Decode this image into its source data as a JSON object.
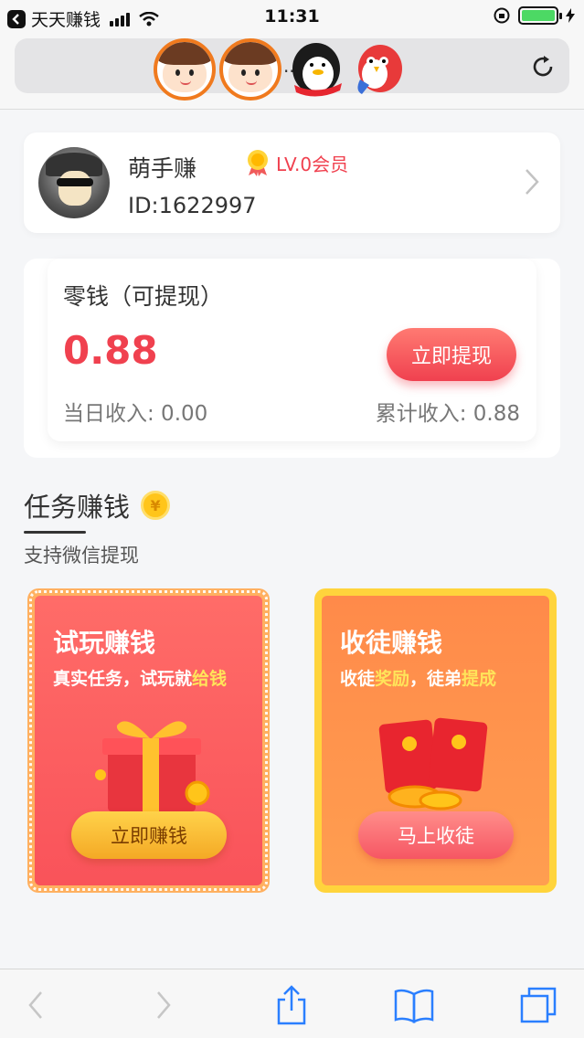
{
  "status_bar": {
    "back_app": "天天赚钱",
    "time": "11:31"
  },
  "browser": {
    "url": "..."
  },
  "user": {
    "name": "萌手赚",
    "id_text": "ID:1622997",
    "level": "LV.0会员"
  },
  "balance": {
    "title": "零钱（可提现）",
    "amount": "0.88",
    "withdraw_label": "立即提现",
    "today_income": "当日收入: 0.00",
    "total_income": "累计收入: 0.88"
  },
  "tasks_section": {
    "title": "任务赚钱",
    "subtitle": "支持微信提现",
    "cards": [
      {
        "title": "试玩赚钱",
        "desc_plain": "真实任务，试玩就",
        "desc_highlight": "给钱",
        "button": "立即赚钱"
      },
      {
        "title": "收徒赚钱",
        "desc_1": "收徒",
        "desc_hl_1": "奖励",
        "desc_2": "，徒弟",
        "desc_hl_2": "提成",
        "button": "马上收徒"
      }
    ]
  },
  "colors": {
    "accent_red": "#f0414f",
    "gold": "#ffc51a",
    "highlight_yellow": "#ffe45a"
  },
  "icons": [
    "back-arrow-icon",
    "signal-icon",
    "wifi-icon",
    "battery-icon",
    "reload-icon",
    "medal-icon",
    "chevron-right-icon",
    "coin-icon",
    "gift-icon",
    "red-envelope-icon",
    "nav-back-icon",
    "nav-forward-icon",
    "share-icon",
    "bookmarks-icon",
    "tabs-icon"
  ]
}
